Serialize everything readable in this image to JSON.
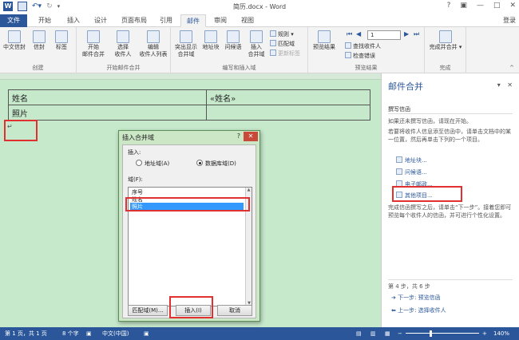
{
  "window": {
    "title": "简历.docx - Word",
    "login": "登录"
  },
  "tabs": [
    "文件",
    "开始",
    "插入",
    "设计",
    "页面布局",
    "引用",
    "邮件",
    "审阅",
    "视图"
  ],
  "ribbon": {
    "groups": {
      "create": {
        "label": "创建",
        "buttons": [
          "中文信封",
          "信封",
          "标签"
        ]
      },
      "start_merge": {
        "label": "开始邮件合并",
        "buttons": [
          "开始\n邮件合并",
          "选择\n收件人",
          "编辑\n收件人列表"
        ]
      },
      "write_insert": {
        "label": "编写和插入域",
        "buttons": [
          "突出显示\n合并域",
          "地址块",
          "问候语",
          "插入\n合并域"
        ],
        "small": [
          "规则",
          "匹配域",
          "更新标签"
        ]
      },
      "preview": {
        "label": "预览结果",
        "button": "预览结果",
        "record_value": "1",
        "small": [
          "查找收件人",
          "检查错误"
        ]
      },
      "finish": {
        "label": "完成",
        "button": "完成并合并"
      }
    }
  },
  "document": {
    "table": [
      [
        "姓名",
        "«姓名»"
      ],
      [
        "照片",
        ""
      ]
    ]
  },
  "pane": {
    "title": "邮件合并",
    "section": "撰写信函",
    "para1": "如果还未撰写信函，请现在开始。",
    "para2": "若要将收件人信息添至信函中，请单击文档中的某一位置，然后再单击下列的一个项目。",
    "links": [
      "地址块...",
      "问候语...",
      "电子邮政...",
      "其他项目..."
    ],
    "para3": "完成信函撰写之后，请单击“下一步”。接着您即可预览每个收件人的信函，并可进行个性化设置。",
    "step": "第 4 步，共 6 步",
    "next": "下一步: 预览信函",
    "prev": "上一步: 选择收件人"
  },
  "dialog": {
    "title": "插入合并域",
    "help": "?",
    "close": "✕",
    "insert_label": "插入:",
    "radio_address": "地址域(A)",
    "radio_db": "数据库域(D)",
    "fields_label": "域(F):",
    "fields": [
      "序号",
      "姓名",
      "照片"
    ],
    "btn_match": "匹配域(M)...",
    "btn_insert": "插入(I)",
    "btn_cancel": "取消"
  },
  "status": {
    "page": "第 1 页，共 1 页",
    "words": "8 个字",
    "lang": "中文(中国)",
    "zoom": "140%"
  },
  "colors": {
    "accent": "#2b579a",
    "doc_bg": "#c6e8cb",
    "highlight_red": "#e03030",
    "selection": "#3399ff"
  }
}
